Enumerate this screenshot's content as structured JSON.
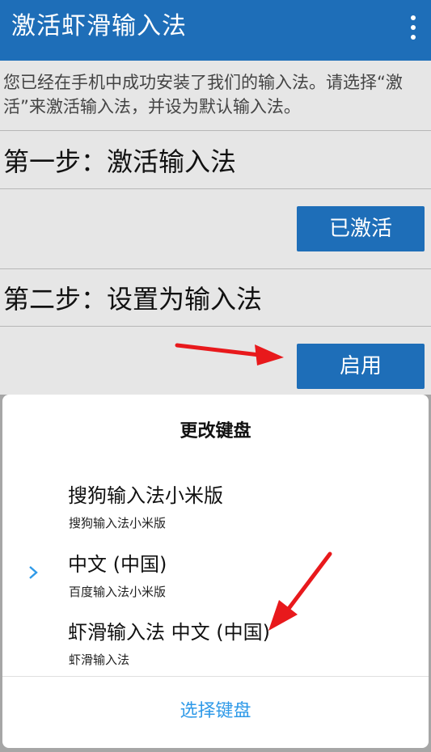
{
  "appbar": {
    "title": "激活虾滑输入法",
    "menu_icon": "more-vert-icon"
  },
  "intro": {
    "text": "您已经在手机中成功安装了我们的输入法。请选择“激活”来激活输入法，并设为默认输入法。"
  },
  "steps": [
    {
      "title": "第一步：激活输入法",
      "button_label": "已激活"
    },
    {
      "title": "第二步：设置为输入法",
      "button_label": "启用"
    }
  ],
  "sheet": {
    "title": "更改键盘",
    "items": [
      {
        "name": "搜狗输入法小米版",
        "subtitle": "搜狗输入法小米版",
        "selected": false
      },
      {
        "name": "中文 (中国)",
        "subtitle": "百度输入法小米版",
        "selected": true
      },
      {
        "name": "虾滑输入法 中文 (中国)",
        "subtitle": "虾滑输入法",
        "selected": false
      }
    ],
    "choose_label": "选择键盘"
  },
  "colors": {
    "accent": "#1e6eb8",
    "link": "#2f9ae8",
    "annotation_arrow": "#e8191c"
  }
}
